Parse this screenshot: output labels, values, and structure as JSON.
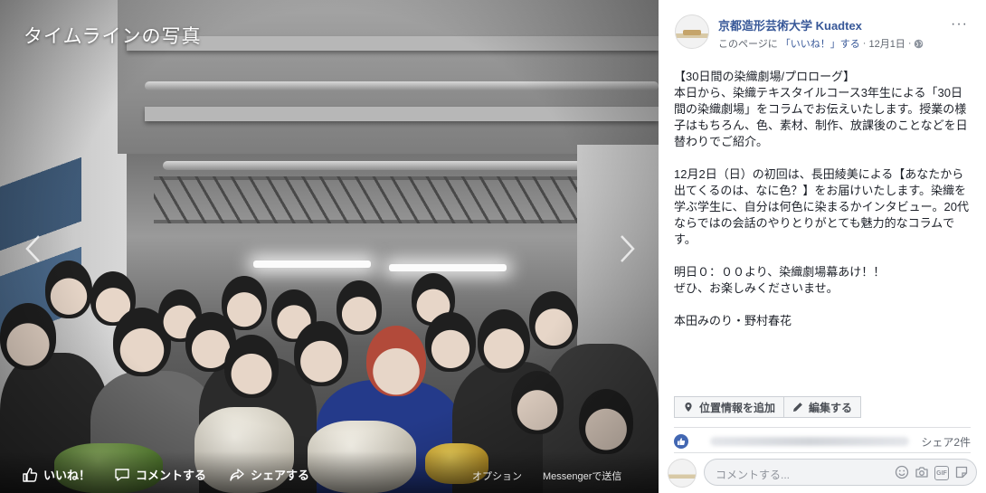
{
  "viewer": {
    "title": "タイムラインの写真",
    "actions": {
      "like": "いいね！",
      "comment": "コメントする",
      "share": "シェアする"
    },
    "right_links": {
      "options": "オプション",
      "messenger": "Messengerで送信"
    },
    "icons": [
      "chevron-left-icon",
      "chevron-right-icon",
      "thumbs-up-icon",
      "comment-icon",
      "share-icon"
    ]
  },
  "post": {
    "page_name": "京都造形芸術大学 Kuadtex",
    "like_page_prefix": "このページに",
    "like_page_link": "「いいね！」する",
    "date": "12月1日",
    "more": "···",
    "paragraphs": [
      "【30日間の染織劇場/プロローグ】\n本日から、染織テキスタイルコース3年生による「30日間の染織劇場」をコラムでお伝えいたします。授業の様子はもちろん、色、素材、制作、放課後のことなどを日替わりでご紹介。",
      "12月2日（日）の初回は、長田綾美による【あなたから出てくるのは、なに色？】をお届けいたします。染織を学ぶ学生に、自分は何色に染まるかインタビュー。20代ならではの会話のやりとりがとても魅力的なコラムです。",
      "明日０：００より、染織劇場幕あけ！！\nぜひ、お楽しみくださいませ。",
      "本田みのり・野村春花"
    ],
    "chips": {
      "location": "位置情報を追加",
      "edit": "編集する"
    },
    "share_count": "シェア2件",
    "comment_placeholder": "コメントする...",
    "brand_color": "#385898"
  }
}
